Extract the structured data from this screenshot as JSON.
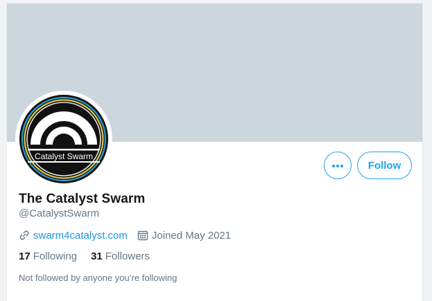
{
  "profile": {
    "display_name": "The Catalyst Swarm",
    "handle": "@CatalystSwarm",
    "website": "swarm4catalyst.com",
    "joined": "Joined May 2021",
    "following_count": "17",
    "following_label": "Following",
    "followers_count": "31",
    "followers_label": "Followers",
    "followers_you_know": "Not followed by anyone you’re following",
    "avatar_text": "Catalyst Swarm"
  },
  "actions": {
    "follow_label": "Follow",
    "more_icon": "more-horizontal-icon"
  },
  "icons": {
    "website": "link-icon",
    "joined": "calendar-icon"
  },
  "colors": {
    "accent": "#1da1f2",
    "banner": "#ccd6dd",
    "text_primary": "#14171a",
    "text_secondary": "#657786"
  }
}
